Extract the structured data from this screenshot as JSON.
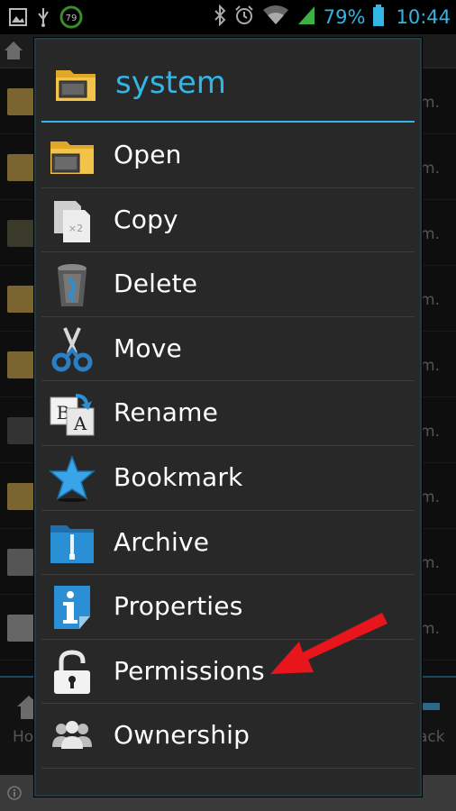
{
  "status_bar": {
    "notification_badge": "79",
    "battery_percent": "79%",
    "time": "10:44",
    "icons": [
      "image-icon",
      "usb-icon",
      "battery-saver-icon",
      "bluetooth-icon",
      "alarm-icon",
      "wifi-icon",
      "signal-icon",
      "battery-icon"
    ],
    "accent": "#33b5e5"
  },
  "background": {
    "row_times": [
      "p.m.",
      "a.m.",
      "p.m.",
      "p.m.",
      "a.m.",
      "p.m.",
      "a.m.",
      "p.m.",
      "a.m.",
      "a.m."
    ],
    "bottom_left_label": "Hom",
    "bottom_right_label": "ack"
  },
  "dialog": {
    "title": "system",
    "title_icon": "folder-monitor-icon",
    "items": [
      {
        "label": "Open",
        "icon": "folder-monitor-icon"
      },
      {
        "label": "Copy",
        "icon": "copy-icon"
      },
      {
        "label": "Delete",
        "icon": "trash-icon"
      },
      {
        "label": "Move",
        "icon": "scissors-icon"
      },
      {
        "label": "Rename",
        "icon": "rename-icon"
      },
      {
        "label": "Bookmark",
        "icon": "star-icon"
      },
      {
        "label": "Archive",
        "icon": "archive-folder-icon"
      },
      {
        "label": "Properties",
        "icon": "info-icon"
      },
      {
        "label": "Permissions",
        "icon": "padlock-icon"
      },
      {
        "label": "Ownership",
        "icon": "users-icon"
      }
    ]
  },
  "annotation": {
    "icon": "red-arrow-icon",
    "color": "#e8151c",
    "points_to": "Permissions"
  }
}
